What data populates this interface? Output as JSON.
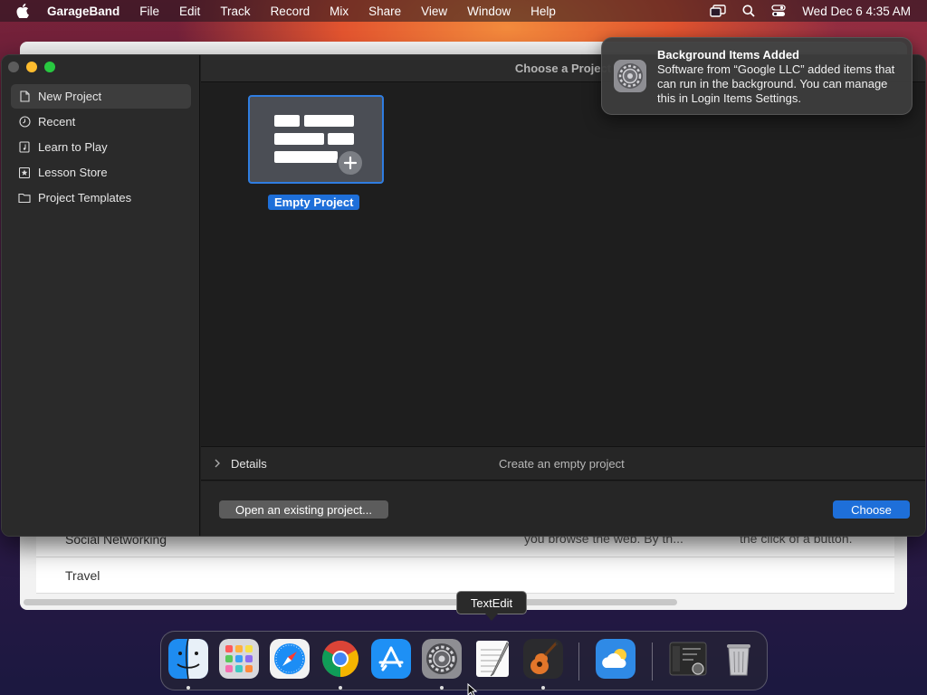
{
  "menubar": {
    "app_name": "GarageBand",
    "menus": [
      "File",
      "Edit",
      "Track",
      "Record",
      "Mix",
      "Share",
      "View",
      "Window",
      "Help"
    ],
    "clock": "Wed Dec 6  4:35 AM"
  },
  "background_window": {
    "rows": [
      "Social Networking",
      "Travel"
    ],
    "ghost_texts": [
      "you browse the web. By th...",
      "the click of a button."
    ]
  },
  "garageband": {
    "window_title": "Choose a Project",
    "sidebar": [
      {
        "label": "New Project",
        "icon": "document-icon",
        "selected": true
      },
      {
        "label": "Recent",
        "icon": "clock-icon",
        "selected": false
      },
      {
        "label": "Learn to Play",
        "icon": "music-book-icon",
        "selected": false
      },
      {
        "label": "Lesson Store",
        "icon": "star-box-icon",
        "selected": false
      },
      {
        "label": "Project Templates",
        "icon": "folder-icon",
        "selected": false
      }
    ],
    "project": {
      "label": "Empty Project"
    },
    "details": {
      "label": "Details",
      "description": "Create an empty project"
    },
    "buttons": {
      "open": "Open an existing project...",
      "choose": "Choose"
    }
  },
  "notification": {
    "title": "Background Items Added",
    "body": "Software from “Google LLC” added items that can run in the background. You can manage this in Login Items Settings."
  },
  "tooltip": "TextEdit",
  "dock": {
    "apps": [
      "Finder",
      "Launchpad",
      "Safari",
      "Google Chrome",
      "App Store",
      "System Settings",
      "TextEdit",
      "GarageBand",
      "Weather",
      "Screenshot",
      "Trash"
    ]
  }
}
